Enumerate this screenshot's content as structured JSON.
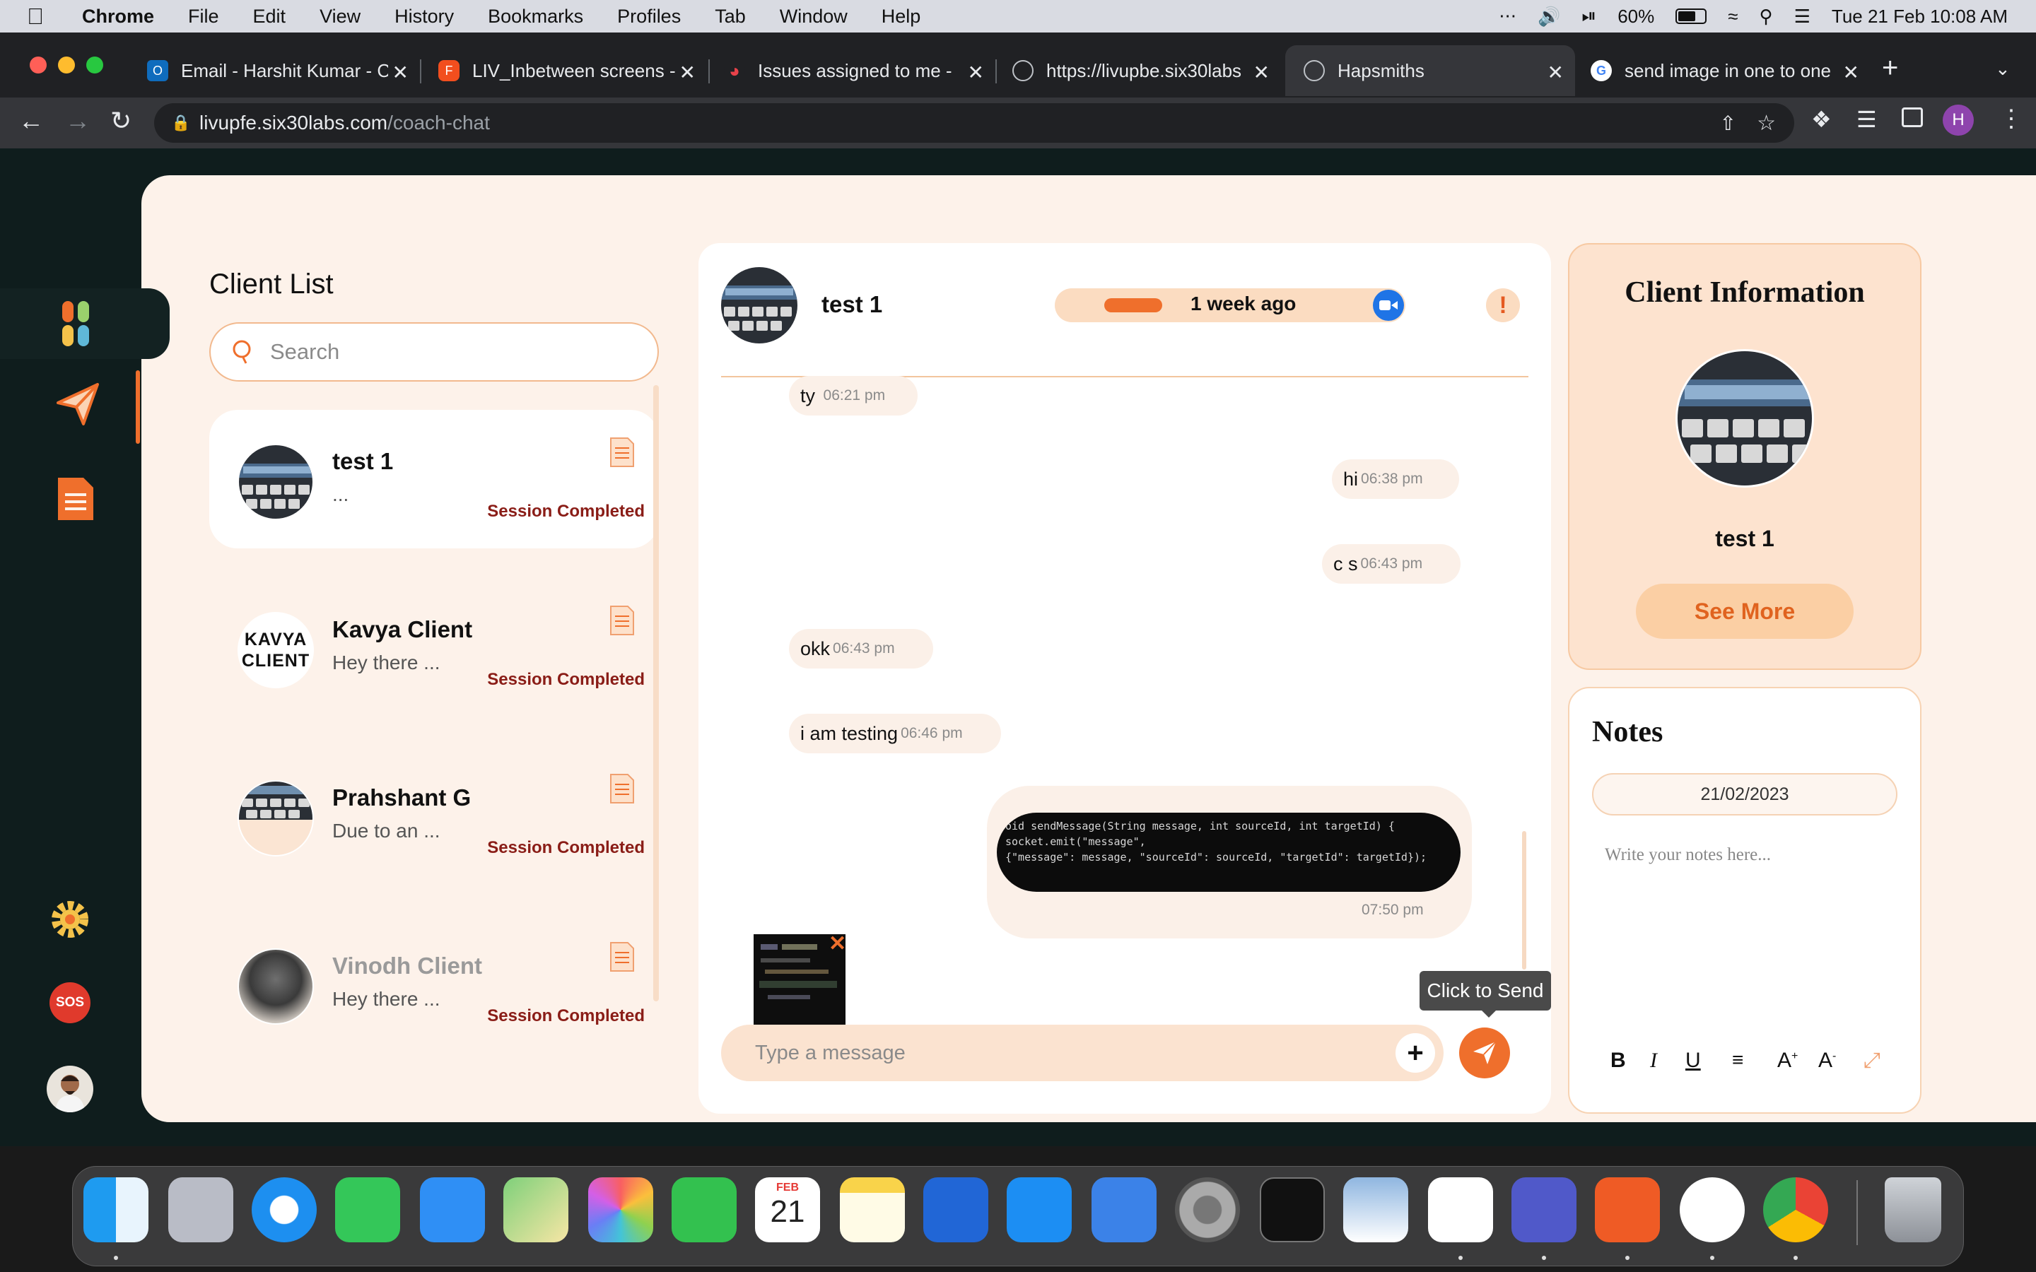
{
  "menubar": {
    "app": "Chrome",
    "items": [
      "File",
      "Edit",
      "View",
      "History",
      "Bookmarks",
      "Profiles",
      "Tab",
      "Window",
      "Help"
    ],
    "battery": "60%",
    "datetime": "Tue 21 Feb  10:08 AM"
  },
  "browser": {
    "tabs": [
      {
        "label": "Email - Harshit Kumar - C",
        "icon": "outlook-icon"
      },
      {
        "label": "LIV_Inbetween screens -",
        "icon": "figma-icon"
      },
      {
        "label": "Issues assigned to me -",
        "icon": "jira-icon"
      },
      {
        "label": "https://livupbe.six30labs",
        "icon": "globe-icon"
      },
      {
        "label": "Hapsmiths",
        "icon": "globe-icon"
      },
      {
        "label": "send image in one to one",
        "icon": "google-icon"
      }
    ],
    "url_host": "livupfe.six30labs.com",
    "url_path": "/coach-chat",
    "profile_initial": "H"
  },
  "client_list": {
    "title": "Client List",
    "search_placeholder": "Search",
    "clients": [
      {
        "name": "test 1",
        "preview": "...",
        "status": "Session Completed"
      },
      {
        "name": "Kavya Client",
        "preview": "Hey there ...",
        "status": "Session Completed",
        "avatar_text": "KAVYA CLIENT"
      },
      {
        "name": "Prahshant G",
        "preview": "Due to an ...",
        "status": "Session Completed"
      },
      {
        "name": "Vinodh Client",
        "preview": "Hey there ...",
        "status": "Session Completed"
      }
    ]
  },
  "sidebar": {
    "sos_label": "SOS"
  },
  "chat": {
    "name": "test 1",
    "last_seen": "1 week ago",
    "messages": [
      {
        "text": "ty",
        "time": "06:21 pm",
        "side": "left"
      },
      {
        "text": "hi",
        "time": "06:38 pm",
        "side": "right"
      },
      {
        "text": "c s",
        "time": "06:43 pm",
        "side": "right"
      },
      {
        "text": "okk",
        "time": "06:43 pm",
        "side": "left"
      },
      {
        "text": "i am testing",
        "time": "06:46 pm",
        "side": "left"
      }
    ],
    "image_message": {
      "time": "07:50 pm",
      "code_lines": [
        "oid sendMessage(String message, int sourceId, int targetId) {",
        "  socket.emit(\"message\",",
        "      {\"message\": message, \"sourceId\": sourceId, \"targetId\": targetId});"
      ]
    },
    "tooltip": "Click to Send",
    "input_placeholder": "Type a message"
  },
  "client_info": {
    "title": "Client Information",
    "name": "test 1",
    "see_more": "See More"
  },
  "notes": {
    "title": "Notes",
    "date": "21/02/2023",
    "placeholder": "Write your notes here..."
  },
  "dock": {
    "calendar_month": "FEB",
    "calendar_day": "21",
    "apps": [
      "finder-icon",
      "launchpad-icon",
      "safari-icon",
      "messages-icon",
      "mail-icon",
      "maps-icon",
      "photos-icon",
      "facetime-icon",
      "calendar-icon",
      "notes-icon",
      "xcode-icon",
      "app-store-icon",
      "simulator-icon",
      "system-preferences-icon",
      "terminal-icon",
      "preview-icon",
      "vscode-icon",
      "teams-icon",
      "postman-icon",
      "android-studio-icon",
      "chrome-icon",
      "trash-icon"
    ]
  },
  "colors": {
    "accent": "#ef6f2c",
    "page_bg": "#fdf2ea",
    "status_text": "#8a1d17",
    "rail_bg": "#0f1d1d"
  }
}
